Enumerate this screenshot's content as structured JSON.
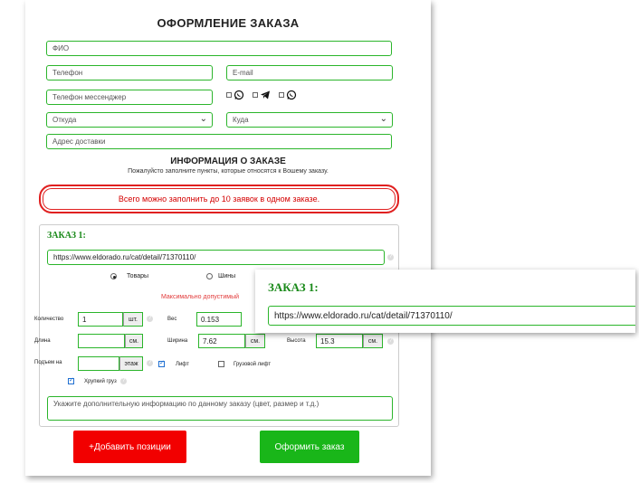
{
  "form": {
    "title": "ОФОРМЛЕНИЕ ЗАКАЗА",
    "fio_placeholder": "ФИО",
    "phone_placeholder": "Телефон",
    "email_placeholder": "E-mail",
    "messenger_placeholder": "Телефон мессенджер",
    "from_label": "Откуда",
    "to_label": "Куда",
    "address_placeholder": "Адрес доставки",
    "messengers": [
      "whatsapp-icon",
      "telegram-icon",
      "whatsapp-icon"
    ]
  },
  "order_info": {
    "title": "ИНФОРМАЦИЯ О ЗАКАЗЕ",
    "note": "Пожалуйсто заполните пункты, которые относятся к Вошему заказу.",
    "alert": "Всего можно заполнить до 10 заявок в одном заказе."
  },
  "order": {
    "title": "ЗАКАЗ 1:",
    "url": "https://www.eldorado.ru/cat/detail/71370110/",
    "type_goods": "Товары",
    "type_tires": "Шины",
    "max_label": "Максимально допустимый",
    "qty_label": "Количество",
    "qty_value": "1",
    "qty_unit": "шт.",
    "weight_label": "Вес",
    "weight_value": "0.153",
    "length_label": "Длина",
    "length_unit": "см.",
    "width_label": "Ширина",
    "width_value": "7.62",
    "width_unit": "см.",
    "height_label": "Высота",
    "height_value": "15.3",
    "height_unit": "см.",
    "floor_label": "Подъем на",
    "floor_unit": "этаж",
    "lift_label": "Лифт",
    "freight_lift_label": "Грузовой лифт",
    "fragile_label": "Хрупкий груз",
    "extra_placeholder": "Укажите дополнительную информацию по данному заказу (цвет, размер и т.д.)"
  },
  "buttons": {
    "add": "+Добавить позиции",
    "submit": "Оформить заказ"
  },
  "colors": {
    "accent_green": "#2bb52b",
    "title_green": "#1a8a1a",
    "add_red": "#f20000",
    "submit_green": "#19b619",
    "alert_red": "#d40000"
  }
}
